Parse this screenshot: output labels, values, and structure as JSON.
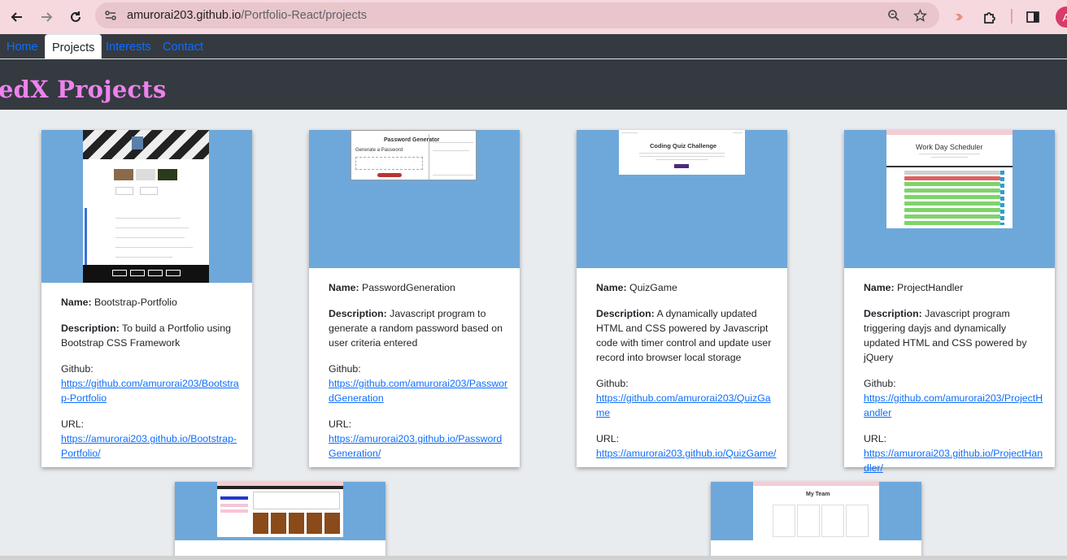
{
  "browser": {
    "url_host": "amurorai203.github.io",
    "url_path": "/Portfolio-React/projects",
    "profile_initial": "A"
  },
  "nav": {
    "tabs": [
      {
        "label": "Home"
      },
      {
        "label": "Projects"
      },
      {
        "label": "Interests"
      },
      {
        "label": "Contact"
      }
    ]
  },
  "page": {
    "title": "edX Projects"
  },
  "labels": {
    "name": "Name:",
    "description": "Description:",
    "github": "Github:",
    "url": "URL:"
  },
  "projects": [
    {
      "name": "Bootstrap-Portfolio",
      "description": "To build a Portfolio using Bootstrap CSS Framework",
      "github": "https://github.com/amurorai203/Bootstrap-Portfolio",
      "url": "https://amurorai203.github.io/Bootstrap-Portfolio/"
    },
    {
      "name": "PasswordGeneration",
      "description": "Javascript program to generate a random password based on user criteria entered",
      "github": "https://github.com/amurorai203/PasswordGeneration",
      "url": "https://amurorai203.github.io/PasswordGeneration/",
      "shot_title": "Password Generator",
      "shot_subtitle": "Generate a Password"
    },
    {
      "name": "QuizGame",
      "description": "A dynamically updated HTML and CSS powered by Javascript code with timer control and update user record into browser local storage",
      "github": "https://github.com/amurorai203/QuizGame",
      "url": "https://amurorai203.github.io/QuizGame/",
      "shot_title": "Coding Quiz Challenge"
    },
    {
      "name": "ProjectHandler",
      "description": "Javascript program triggering dayjs and dynamically updated HTML and CSS powered by jQuery",
      "github": "https://github.com/amurorai203/ProjectHandler",
      "url": "https://amurorai203.github.io/ProjectHandler/",
      "shot_title": "Work Day Scheduler"
    }
  ],
  "partial_cards": [
    {
      "shot_title": ""
    },
    {
      "shot_title": "My Team"
    }
  ]
}
